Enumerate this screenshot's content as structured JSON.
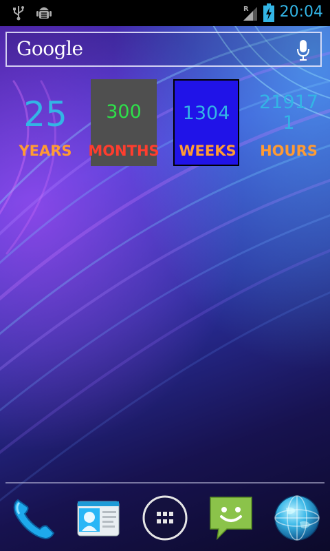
{
  "status_bar": {
    "time": "20:04",
    "left_icons": [
      "usb-icon",
      "android-debug-icon"
    ],
    "right_icons": [
      "signal-roaming-icon",
      "battery-charging-icon"
    ],
    "roaming_label": "R"
  },
  "search": {
    "label": "Google",
    "mic_icon": "microphone-icon"
  },
  "widgets": [
    {
      "value": "25",
      "unit": "YEARS"
    },
    {
      "value": "300",
      "unit": "MONTHS"
    },
    {
      "value": "1304",
      "unit": "WEEKS"
    },
    {
      "value_line1": "21917",
      "value_line2": "1",
      "unit": "HOURS"
    }
  ],
  "colors": {
    "clock": "#33b5e5",
    "years_value": "#33b5e5",
    "months_value": "#2ee04a",
    "weeks_value": "#33b5e5",
    "hours_value": "#33b5e5",
    "label_orange": "#ff9b33",
    "label_red": "#ff3d2e",
    "months_bg": "#4f4f4f",
    "weeks_bg": "#2013e8"
  },
  "dock": {
    "items": [
      {
        "icon": "phone-icon"
      },
      {
        "icon": "contacts-icon"
      },
      {
        "icon": "all-apps-icon"
      },
      {
        "icon": "messaging-icon"
      },
      {
        "icon": "browser-icon"
      }
    ]
  }
}
